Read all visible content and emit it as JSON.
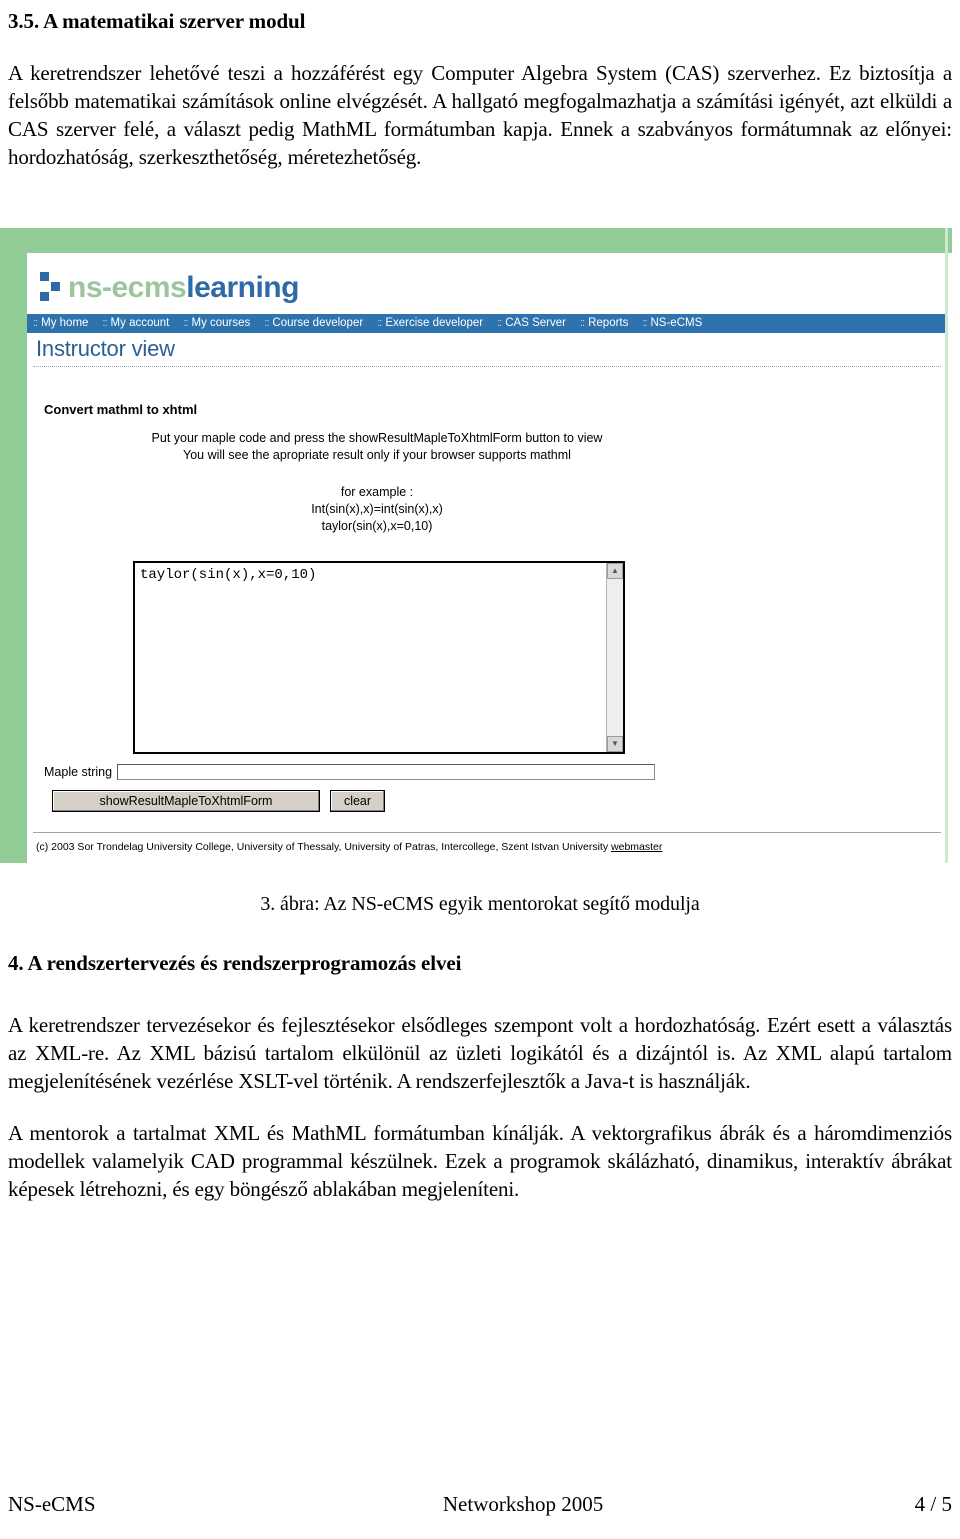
{
  "document": {
    "section_heading": "3.5. A matematikai szerver modul",
    "intro_paragraph": "A keretrendszer lehetővé teszi a hozzáférést egy Computer Algebra System (CAS) szerverhez. Ez biztosítja a felsőbb matematikai számítások online elvégzését. A hallgató megfogalmazhatja a számítási igényét, azt elküldi a CAS szerver felé, a választ pedig MathML formátumban kapja. Ennek a szabványos formátumnak az előnyei: hordozhatóság, szerkeszthetőség, méretezhetőség.",
    "figure_caption": "3. ábra: Az NS-eCMS egyik mentorokat segítő modulja",
    "section4_heading": "4. A rendszertervezés és rendszerprogramozás elvei",
    "paragraph_1": "A keretrendszer tervezésekor és fejlesztésekor elsődleges szempont volt a hordozhatóság. Ezért esett a választás az XML-re. Az XML bázisú tartalom elkülönül az üzleti logikától és a dizájntól is. Az XML alapú tartalom megjelenítésének vezérlése XSLT-vel történik. A rendszerfejlesztők a Java-t is használják.",
    "paragraph_2": "A mentorok a tartalmat XML és MathML formátumban kínálják. A vektorgrafikus ábrák és a háromdimenziós modellek valamelyik CAD programmal készülnek. Ezek a programok skálázható, dinamikus, interaktív ábrákat képesek létrehozni, és egy böngésző ablakában megjeleníteni."
  },
  "page_footer": {
    "left": "NS-eCMS",
    "center": "Networkshop 2005",
    "right": "4 / 5"
  },
  "screenshot": {
    "logo": {
      "name_light": "ns-ecms",
      "name_bold": "learning",
      "mark_icon": "three-blue-squares-logo-icon"
    },
    "nav": {
      "separator": "::",
      "items": [
        {
          "label": "My home"
        },
        {
          "label": "My account"
        },
        {
          "label": "My courses"
        },
        {
          "label": "Course developer"
        },
        {
          "label": "Exercise developer"
        },
        {
          "label": "CAS Server"
        },
        {
          "label": "Reports"
        },
        {
          "label": "NS-eCMS"
        }
      ]
    },
    "view_title": "Instructor view",
    "form": {
      "title": "Convert mathml to xhtml",
      "instruction_line1": "Put your maple code and press the showResultMapleToXhtmlForm button to view",
      "instruction_line2": "You will see the apropriate result only if your browser supports mathml",
      "example_label": "for example :",
      "example_line1": "Int(sin(x),x)=int(sin(x),x)",
      "example_line2": "taylor(sin(x),x=0,10)",
      "textarea_value": "taylor(sin(x),x=0,10)",
      "scroll_up_icon": "▲",
      "scroll_down_icon": "▼",
      "maple_label": "Maple string",
      "maple_value": "",
      "maple_placeholder": "",
      "submit_label": "showResultMapleToXhtmlForm",
      "clear_label": "clear"
    },
    "footer": {
      "text": "(c) 2003 Sor Trondelag University College, University of Thessaly, University of Patras, Intercollege, Szent Istvan University ",
      "link": "webmaster"
    },
    "colors": {
      "green_background": "#92cd98",
      "nav_blue": "#2e72ae",
      "logo_blue": "#2e6aa8",
      "logo_green": "#9ec49b",
      "title_blue": "#2b5f93"
    }
  }
}
